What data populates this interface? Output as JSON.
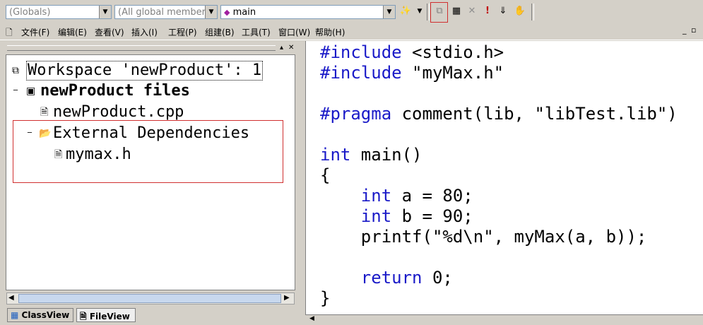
{
  "toolbar": {
    "combo_globals": "(Globals)",
    "combo_members": "(All global members",
    "combo_function": "main",
    "icons": [
      "wizard-icon",
      "compile-icon",
      "build-icon",
      "stop-build-icon",
      "execute-icon",
      "go-icon",
      "breakpoint-icon"
    ]
  },
  "menubar": {
    "items": [
      "文件(F)",
      "编辑(E)",
      "查看(V)",
      "插入(I)",
      "工程(P)",
      "组建(B)",
      "工具(T)",
      "窗口(W)",
      "帮助(H)"
    ]
  },
  "workspace": {
    "root": "Workspace 'newProduct': 1",
    "project": "newProduct files",
    "source_file": "newProduct.cpp",
    "ext_deps": "External Dependencies",
    "header_file": "mymax.h"
  },
  "tabs": {
    "classview": "ClassView",
    "fileview": "FileView"
  },
  "editor": {
    "lines": [
      {
        "kw": "#include",
        "rest": " <stdio.h>"
      },
      {
        "kw": "#include",
        "rest": " \"myMax.h\""
      },
      {
        "kw": "",
        "rest": ""
      },
      {
        "kw": "#pragma",
        "rest": " comment(lib, \"libTest.lib\")"
      },
      {
        "kw": "",
        "rest": ""
      },
      {
        "kw": "int",
        "rest": " main()"
      },
      {
        "kw": "",
        "rest": "{"
      },
      {
        "pre": "    ",
        "kw": "int",
        "rest": " a = 80;"
      },
      {
        "pre": "    ",
        "kw": "int",
        "rest": " b = 90;"
      },
      {
        "pre": "    ",
        "kw": "",
        "rest": "printf(\"%d\\n\", myMax(a, b));"
      },
      {
        "kw": "",
        "rest": ""
      },
      {
        "pre": "    ",
        "kw": "return",
        "rest": " 0;"
      },
      {
        "kw": "",
        "rest": "}"
      }
    ]
  }
}
